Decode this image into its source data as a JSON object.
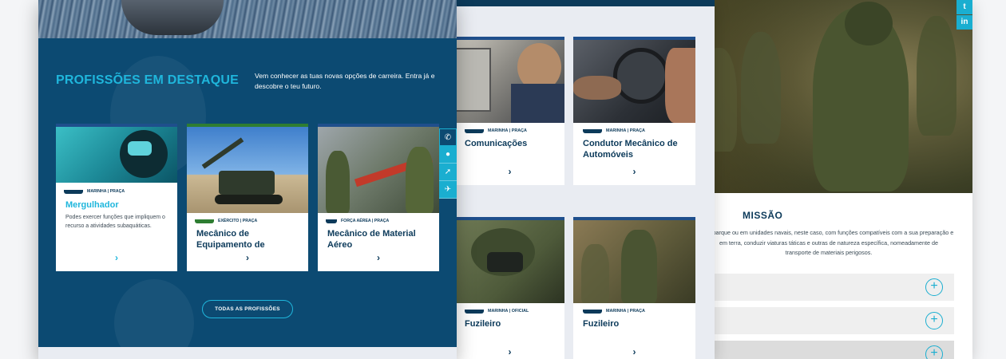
{
  "left_panel": {
    "section_title": "PROFISSÕES EM DESTAQUE",
    "section_subtitle": "Vem conhecer as tuas novas opções de carreira. Entra já e descobre o teu futuro.",
    "cards": [
      {
        "tag": "MARINHA | PRAÇA",
        "title": "Mergulhador",
        "description": "Podes exercer funções que impliquem o recurso a atividades subaquáticas.",
        "accent": "#1fb6dc",
        "title_color": "#1fb6dc"
      },
      {
        "tag": "EXÉRCITO | PRAÇA",
        "title": "Mecânico de Equipamento de",
        "accent": "#2e7d32",
        "title_color": "#0c3a5a"
      },
      {
        "tag": "FORÇA AÉREA | PRAÇA",
        "title": "Mecânico de Material Aéreo",
        "accent": "#1f4f8c",
        "title_color": "#0c3a5a"
      }
    ],
    "all_button": "TODAS AS PROFISSÕES",
    "side_tools": [
      "phone-icon",
      "bell-icon",
      "share-icon",
      "plane-icon"
    ]
  },
  "middle_panel": {
    "cards": [
      {
        "tag": "MARINHA | PRAÇA",
        "title": "Comunicações"
      },
      {
        "tag": "MARINHA | PRAÇA",
        "title": "Condutor Mecânico de Automóveis"
      },
      {
        "tag": "MARINHA | OFICIAL",
        "title": "Fuzileiro"
      },
      {
        "tag": "MARINHA | PRAÇA",
        "title": "Fuzileiro"
      }
    ]
  },
  "right_panel": {
    "social": [
      "t",
      "in"
    ],
    "missao_title": "MISSÃO",
    "missao_text_1": "Embarque ou em unidades navais, neste caso, com funções compatíveis com a sua preparação e",
    "missao_text_2": "em terra, conduzir viaturas táticas e outras de natureza específica, nomeadamente de",
    "missao_text_3": "transporte de materiais perigosos."
  },
  "colors": {
    "navy": "#0c4a72",
    "accent": "#1fb6dc",
    "dark_text": "#0c3a5a"
  }
}
